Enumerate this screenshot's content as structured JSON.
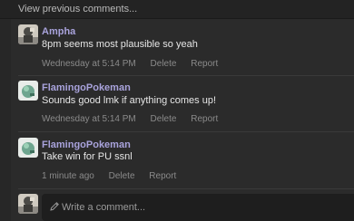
{
  "thread": {
    "view_previous_label": "View previous comments..."
  },
  "comments": [
    {
      "author": "Ampha",
      "text": "8pm seems most plausible so yeah",
      "time": "Wednesday at 5:14 PM",
      "delete_label": "Delete",
      "report_label": "Report"
    },
    {
      "author": "FlamingoPokeman",
      "text": "Sounds good lmk if anything comes up!",
      "time": "Wednesday at 5:14 PM",
      "delete_label": "Delete",
      "report_label": "Report"
    },
    {
      "author": "FlamingoPokeman",
      "text": "Take win for PU ssnl",
      "time": "1 minute ago",
      "delete_label": "Delete",
      "report_label": "Report"
    }
  ],
  "composer": {
    "placeholder": "Write a comment..."
  },
  "colors": {
    "background": "#2b2b2b",
    "author": "#a9a3dc",
    "text": "#e6e6e6",
    "meta": "#8a8a8a"
  }
}
